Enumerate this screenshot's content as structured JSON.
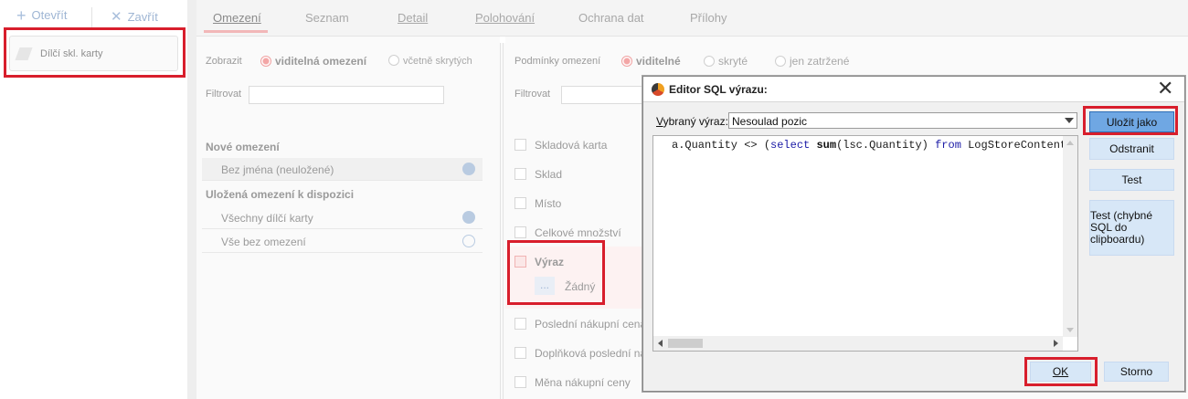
{
  "toolbar": {
    "open_label": "Otevřít",
    "close_label": "Zavřít"
  },
  "left": {
    "card_label": "Dílčí skl. karty"
  },
  "tabs": [
    {
      "label": "Omezení"
    },
    {
      "label": "Seznam"
    },
    {
      "label": "Detail"
    },
    {
      "label": "Polohování"
    },
    {
      "label": "Ochrana dat"
    },
    {
      "label": "Přílohy"
    }
  ],
  "filter_pane": {
    "show_label": "Zobrazit",
    "option_visible": "viditelná omezení",
    "option_hidden": "včetně skrytých",
    "filter_label": "Filtrovat",
    "new_section": "Nové omezení",
    "new_item": "Bez jména (neuložené)",
    "saved_section": "Uložená omezení k dispozici",
    "saved_items": [
      "Všechny dílčí karty",
      "Vše bez omezení"
    ]
  },
  "conditions_pane": {
    "conditions_label": "Podmínky omezení",
    "opt_visible": "viditelné",
    "opt_hidden": "skryté",
    "opt_filled": "jen zatržené",
    "filter_label": "Filtrovat",
    "rows": [
      "Skladová karta",
      "Sklad",
      "Místo",
      "Celkové množství"
    ],
    "expr_label": "Výraz",
    "expr_dots": "...",
    "expr_value": "Žádný",
    "rows_after": [
      "Poslední nákupní cena",
      "Doplňková poslední náku",
      "Měna nákupní ceny"
    ]
  },
  "dialog": {
    "title": "Editor SQL výrazu:",
    "close_glyph": "✕",
    "selected_label": "Vybraný výraz:",
    "selected_value": "Nesoulad pozic",
    "code_prefix": "a.Quantity <> (",
    "code_kw1": "select",
    "code_fn": "sum",
    "code_mid": "(lsc.Quantity) ",
    "code_kw2": "from",
    "code_tail": " LogStoreContents",
    "btn_save_as": "Uložit jako",
    "btn_remove": "Odstranit",
    "btn_test": "Test",
    "btn_test_clip": "Test (chybné SQL do clipboardu)",
    "btn_ok": "OK",
    "btn_cancel": "Storno"
  },
  "colors": {
    "highlight": "#d81e2c",
    "primary_button": "#6fa7e3",
    "button": "#d7e7f7"
  }
}
